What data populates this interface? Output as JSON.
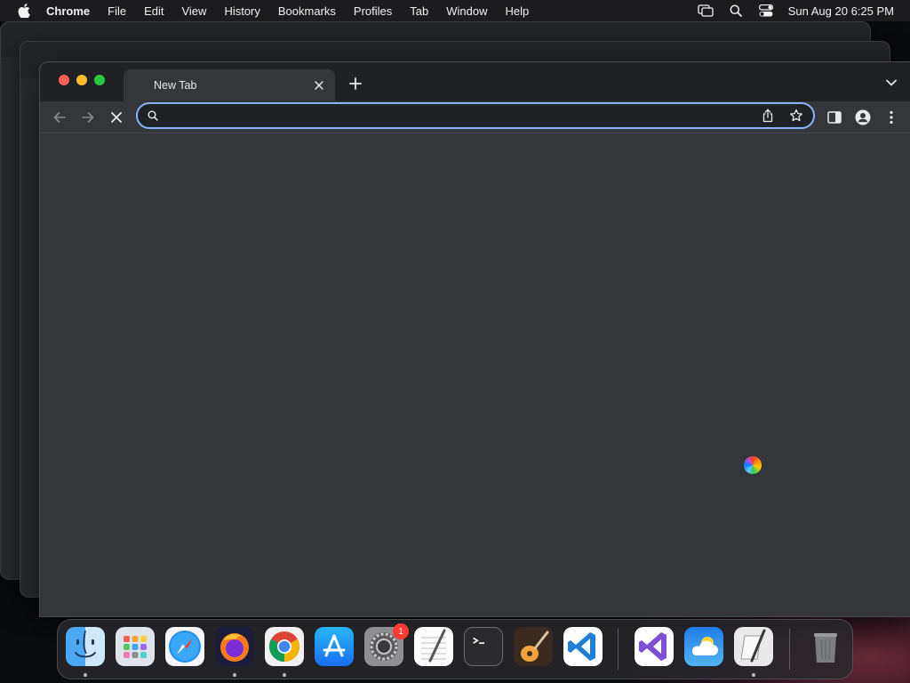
{
  "menubar": {
    "app_name": "Chrome",
    "items": [
      "File",
      "Edit",
      "View",
      "History",
      "Bookmarks",
      "Profiles",
      "Tab",
      "Window",
      "Help"
    ],
    "clock": "Sun Aug 20  6:25 PM"
  },
  "browser": {
    "tab": {
      "title": "New Tab"
    },
    "omnibox": {
      "value": "",
      "placeholder": ""
    }
  },
  "dock": {
    "apps": [
      "Finder",
      "Launchpad",
      "Safari",
      "Firefox",
      "Google Chrome",
      "App Store",
      "System Settings",
      "TextEdit",
      "Terminal",
      "GarageBand",
      "Visual Studio Code",
      "Visual Studio",
      "Weather",
      "Script Editor",
      "Trash"
    ],
    "system_settings_badge": "1"
  },
  "colors": {
    "accent": "#8ab4f8",
    "tabstrip": "#202124",
    "toolbar": "#35363a"
  }
}
